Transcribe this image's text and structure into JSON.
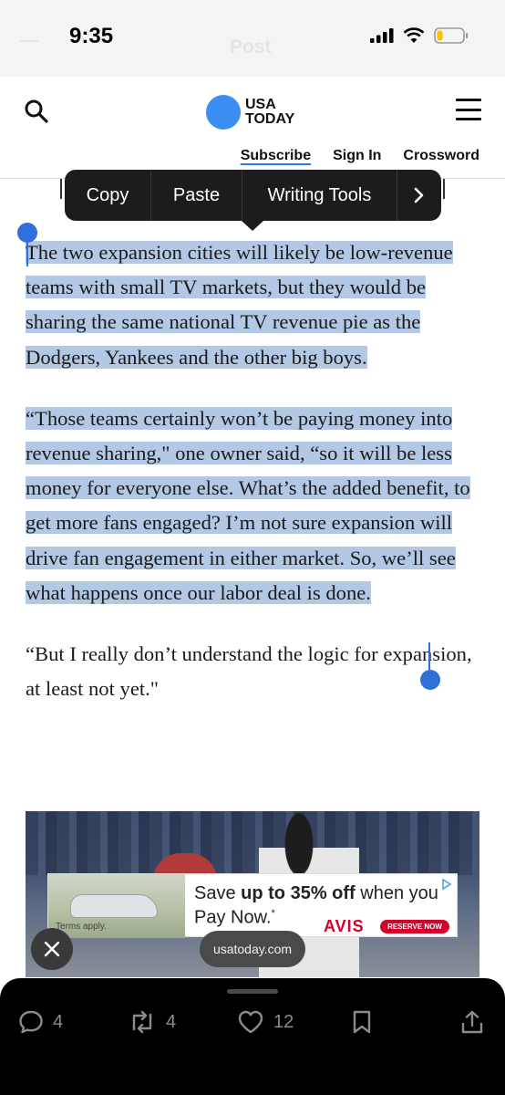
{
  "status_bar": {
    "time": "9:35",
    "ghost_title": "Post"
  },
  "header": {
    "logo_line1": "USA",
    "logo_line2": "TODAY",
    "brand_color": "#3b8ff3",
    "nav": {
      "subscribe": "Subscribe",
      "sign_in": "Sign In",
      "crossword": "Crossword"
    }
  },
  "context_menu": {
    "copy": "Copy",
    "paste": "Paste",
    "writing_tools": "Writing Tools",
    "more_icon": "chevron-right-icon"
  },
  "article": {
    "p1": "The two expansion cities will likely be low-revenue teams with small TV markets, but they would be sharing the same national TV revenue pie as the Dodgers, Yankees and the other big boys.",
    "p2": "“Those teams certainly won’t be paying money into revenue sharing,\" one owner said, “so it will be less money for everyone else.  What’s the added benefit, to get more fans engaged? I’m not sure expansion will drive fan engagement in either market. So, we’ll see what happens once our labor deal is done.",
    "p3": "“But I really don’t understand the logic for expansion, at least not yet.\"",
    "selection_color": "#b2c8e4"
  },
  "ad": {
    "text_prefix": "Save ",
    "text_bold": "up to 35% off",
    "text_suffix": " when you Pay Now.",
    "footnote_mark": "*",
    "brand": "AVIS",
    "cta": "RESERVE NOW",
    "fine_print": "Terms apply."
  },
  "overlay": {
    "url": "usatoday.com"
  },
  "bottom_bar": {
    "replies": "4",
    "reposts": "4",
    "likes": "12"
  }
}
